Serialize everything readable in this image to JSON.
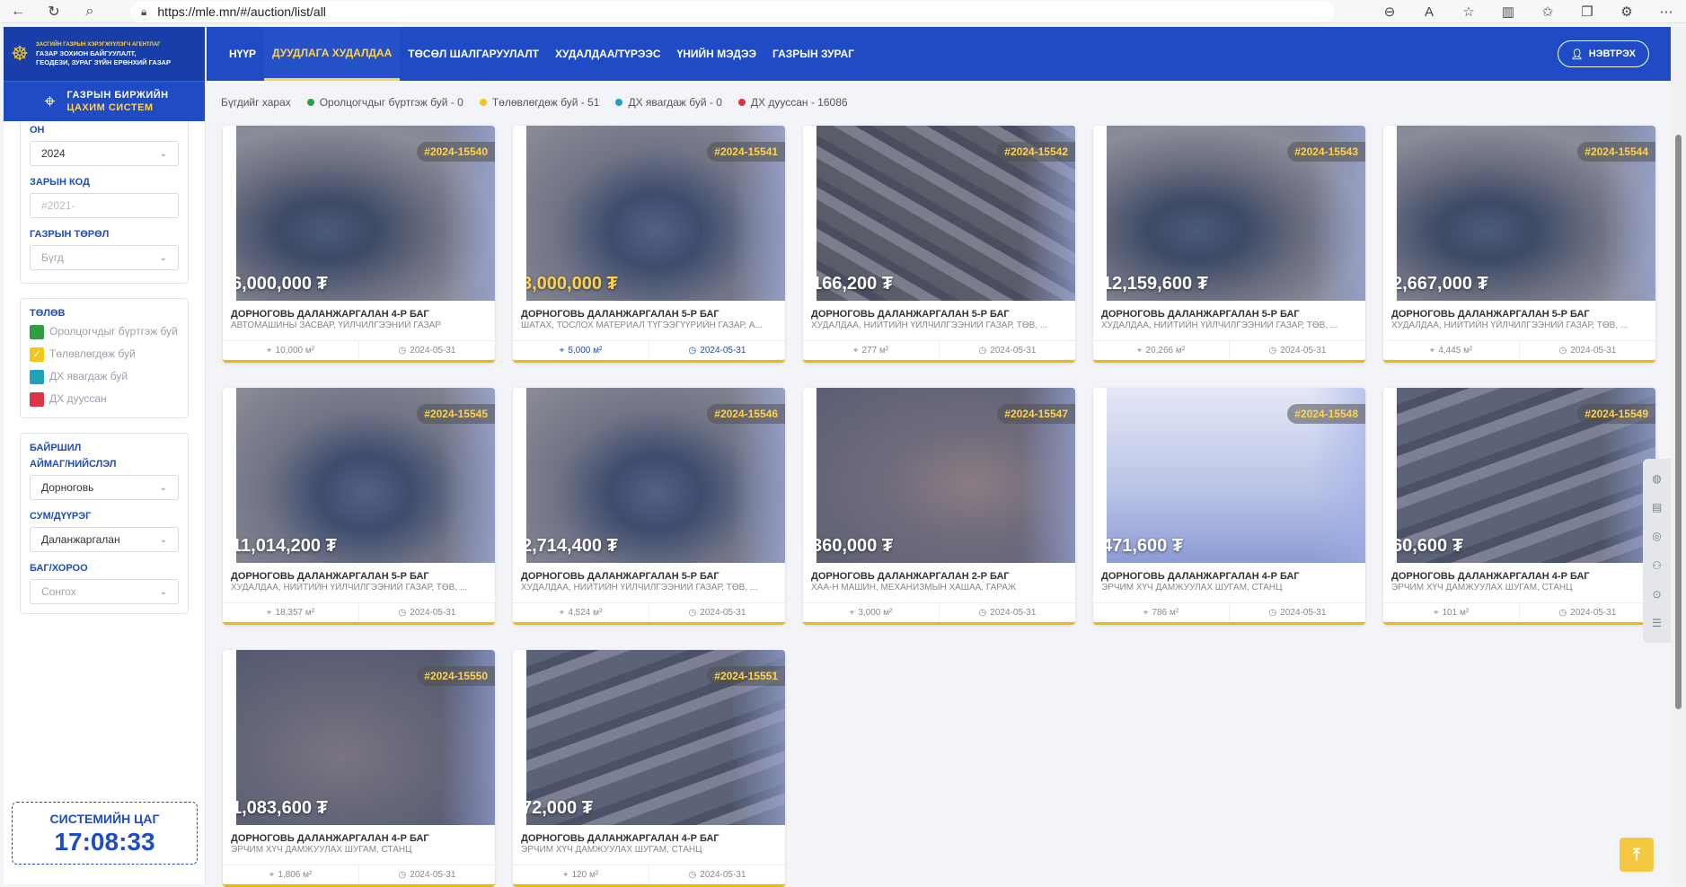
{
  "browser": {
    "url": "https://mle.mn/#/auction/list/all"
  },
  "logo": {
    "line0": "ЗАСГИЙН ГАЗРЫН ХЭРЭГЖҮҮЛЭГЧ АГЕНТЛАГ",
    "line1": "ГАЗАР ЗОХИОН БАЙГУУЛАЛТ,",
    "line2": "ГЕОДЕЗИ, ЗУРАГ ЗҮЙН ЕРӨНХИЙ ГАЗАР"
  },
  "exchange": {
    "line1": "ГАЗРЫН БИРЖИЙН",
    "line2": "ЦАХИМ СИСТЕМ"
  },
  "nav": {
    "items": [
      "НҮҮР",
      "ДУУДЛАГА ХУДАЛДАА",
      "ТӨСӨЛ ШАЛГАРУУЛАЛТ",
      "ХУДАЛДАА/ТҮРЭЭС",
      "ҮНИЙН МЭДЭЭ",
      "ГАЗРЫН ЗУРАГ"
    ],
    "active_index": 1,
    "login_label": "НЭВТРЭХ"
  },
  "filters": {
    "year_label": "ОН",
    "year_value": "2024",
    "code_label": "ЗАРЫН КОД",
    "code_placeholder": "#2021-",
    "land_type_label": "ГАЗРЫН ТӨРӨЛ",
    "land_type_value": "Бүгд",
    "status_label": "ТӨЛӨВ",
    "statuses": [
      {
        "label": "Оролцогчдыг бүртгэж буй",
        "color": "#2e9e3e"
      },
      {
        "label": "Төлөвлөгдөж буй",
        "color": "#f5c518"
      },
      {
        "label": "ДХ явагдаж буй",
        "color": "#1fa3b8"
      },
      {
        "label": "ДХ дууссан",
        "color": "#dc3545"
      }
    ],
    "location_label": "БАЙРШИЛ",
    "aimag_label": "АЙМАГ/НИЙСЛЭЛ",
    "aimag_value": "Дорноговь",
    "sum_label": "СУМ/ДҮҮРЭГ",
    "sum_value": "Даланжаргалан",
    "bag_label": "БАГ/ХОРОО",
    "bag_value": "Сонгох"
  },
  "clock": {
    "label": "СИСТЕМИЙН ЦАГ",
    "time": "17:08:33"
  },
  "legend": {
    "all": "Бүгдийг харах",
    "items": [
      {
        "label": "Оролцогчдыг бүртгэж буй - 0",
        "color": "#2e9e3e"
      },
      {
        "label": "Төлөвлөгдөж буй - 51",
        "color": "#f5c518"
      },
      {
        "label": "ДХ явагдаж буй - 0",
        "color": "#1fa3b8"
      },
      {
        "label": "ДХ дууссан - 16086",
        "color": "#dc3545"
      }
    ]
  },
  "cards": [
    {
      "id": "#2024-15540",
      "price": "6,000,000 ₮",
      "title": "ДОРНОГОВЬ ДАЛАНЖАРГАЛАН 4-Р БАГ",
      "sub": "АВТОМАШИНЫ ЗАСВАР, ҮЙЛЧИЛГЭЭНИЙ ГАЗАР",
      "area": "10,000 м²",
      "date": "2024-05-31",
      "img": "sat-a"
    },
    {
      "id": "#2024-15541",
      "price": "3,000,000 ₮",
      "title": "ДОРНОГОВЬ ДАЛАНЖАРГАЛАН 5-Р БАГ",
      "sub": "ШАТАХ, ТОСЛОХ МАТЕРИАЛ ТҮГЭЭГҮҮРИЙН ГАЗАР, А...",
      "area": "5,000 м²",
      "date": "2024-05-31",
      "img": "sat-b"
    },
    {
      "id": "#2024-15542",
      "price": "166,200 ₮",
      "title": "ДОРНОГОВЬ ДАЛАНЖАРГАЛАН 5-Р БАГ",
      "sub": "ХУДАЛДАА, НИЙТИЙН ҮЙЛЧИЛГЭЭНИЙ ГАЗАР, ТӨВ, ...",
      "area": "277 м²",
      "date": "2024-05-31",
      "img": "sat-c"
    },
    {
      "id": "#2024-15543",
      "price": "12,159,600 ₮",
      "title": "ДОРНОГОВЬ ДАЛАНЖАРГАЛАН 5-Р БАГ",
      "sub": "ХУДАЛДАА, НИЙТИЙН ҮЙЛЧИЛГЭЭНИЙ ГАЗАР, ТӨВ, ...",
      "area": "20,266 м²",
      "date": "2024-05-31",
      "img": "sat-a"
    },
    {
      "id": "#2024-15544",
      "price": "2,667,000 ₮",
      "title": "ДОРНОГОВЬ ДАЛАНЖАРГАЛАН 5-Р БАГ",
      "sub": "ХУДАЛДАА, НИЙТИЙН ҮЙЛЧИЛГЭЭНИЙ ГАЗАР, ТӨВ, ...",
      "area": "4,445 м²",
      "date": "2024-05-31",
      "img": "sat-a"
    },
    {
      "id": "#2024-15545",
      "price": "11,014,200 ₮",
      "title": "ДОРНОГОВЬ ДАЛАНЖАРГАЛАН 5-Р БАГ",
      "sub": "ХУДАЛДАА, НИЙТИЙН ҮЙЛЧИЛГЭЭНИЙ ГАЗАР, ТӨВ, ...",
      "area": "18,357 м²",
      "date": "2024-05-31",
      "img": "sat-b"
    },
    {
      "id": "#2024-15546",
      "price": "2,714,400 ₮",
      "title": "ДОРНОГОВЬ ДАЛАНЖАРГАЛАН 5-Р БАГ",
      "sub": "ХУДАЛДАА, НИЙТИЙН ҮЙЛЧИЛГЭЭНИЙ ГАЗАР, ТӨВ, ...",
      "area": "4,524 м²",
      "date": "2024-05-31",
      "img": "sat-b"
    },
    {
      "id": "#2024-15547",
      "price": "360,000 ₮",
      "title": "ДОРНОГОВЬ ДАЛАНЖАРГАЛАН 2-Р БАГ",
      "sub": "ХАА-Н МАШИН, МЕХАНИЗМЫН ХАШАА, ГАРАЖ",
      "area": "3,000 м²",
      "date": "2024-05-31",
      "img": "sat-d"
    },
    {
      "id": "#2024-15548",
      "price": "471,600 ₮",
      "title": "ДОРНОГОВЬ ДАЛАНЖАРГАЛАН 4-Р БАГ",
      "sub": "ЭРЧИМ ХҮЧ ДАМЖУУЛАХ ШУГАМ, СТАНЦ",
      "area": "786 м²",
      "date": "2024-05-31",
      "img": "sat-e"
    },
    {
      "id": "#2024-15549",
      "price": "60,600 ₮",
      "title": "ДОРНОГОВЬ ДАЛАНЖАРГАЛАН 4-Р БАГ",
      "sub": "ЭРЧИМ ХҮЧ ДАМЖУУЛАХ ШУГАМ, СТАНЦ",
      "area": "101 м²",
      "date": "2024-05-31",
      "img": "sat-f"
    },
    {
      "id": "#2024-15550",
      "price": "1,083,600 ₮",
      "title": "ДОРНОГОВЬ ДАЛАНЖАРГАЛАН 4-Р БАГ",
      "sub": "ЭРЧИМ ХҮЧ ДАМЖУУЛАХ ШУГАМ, СТАНЦ",
      "area": "1,806 м²",
      "date": "2024-05-31",
      "img": "sat-g"
    },
    {
      "id": "#2024-15551",
      "price": "72,000 ₮",
      "title": "ДОРНОГОВЬ ДАЛАНЖАРГАЛАН 4-Р БАГ",
      "sub": "ЭРЧИМ ХҮЧ ДАМЖУУЛАХ ШУГАМ, СТАНЦ",
      "area": "120 м²",
      "date": "2024-05-31",
      "img": "sat-f"
    }
  ],
  "highlighted_card_index": 1,
  "colors": {
    "primary": "#1f4cc4",
    "accent": "#ffd34d"
  }
}
